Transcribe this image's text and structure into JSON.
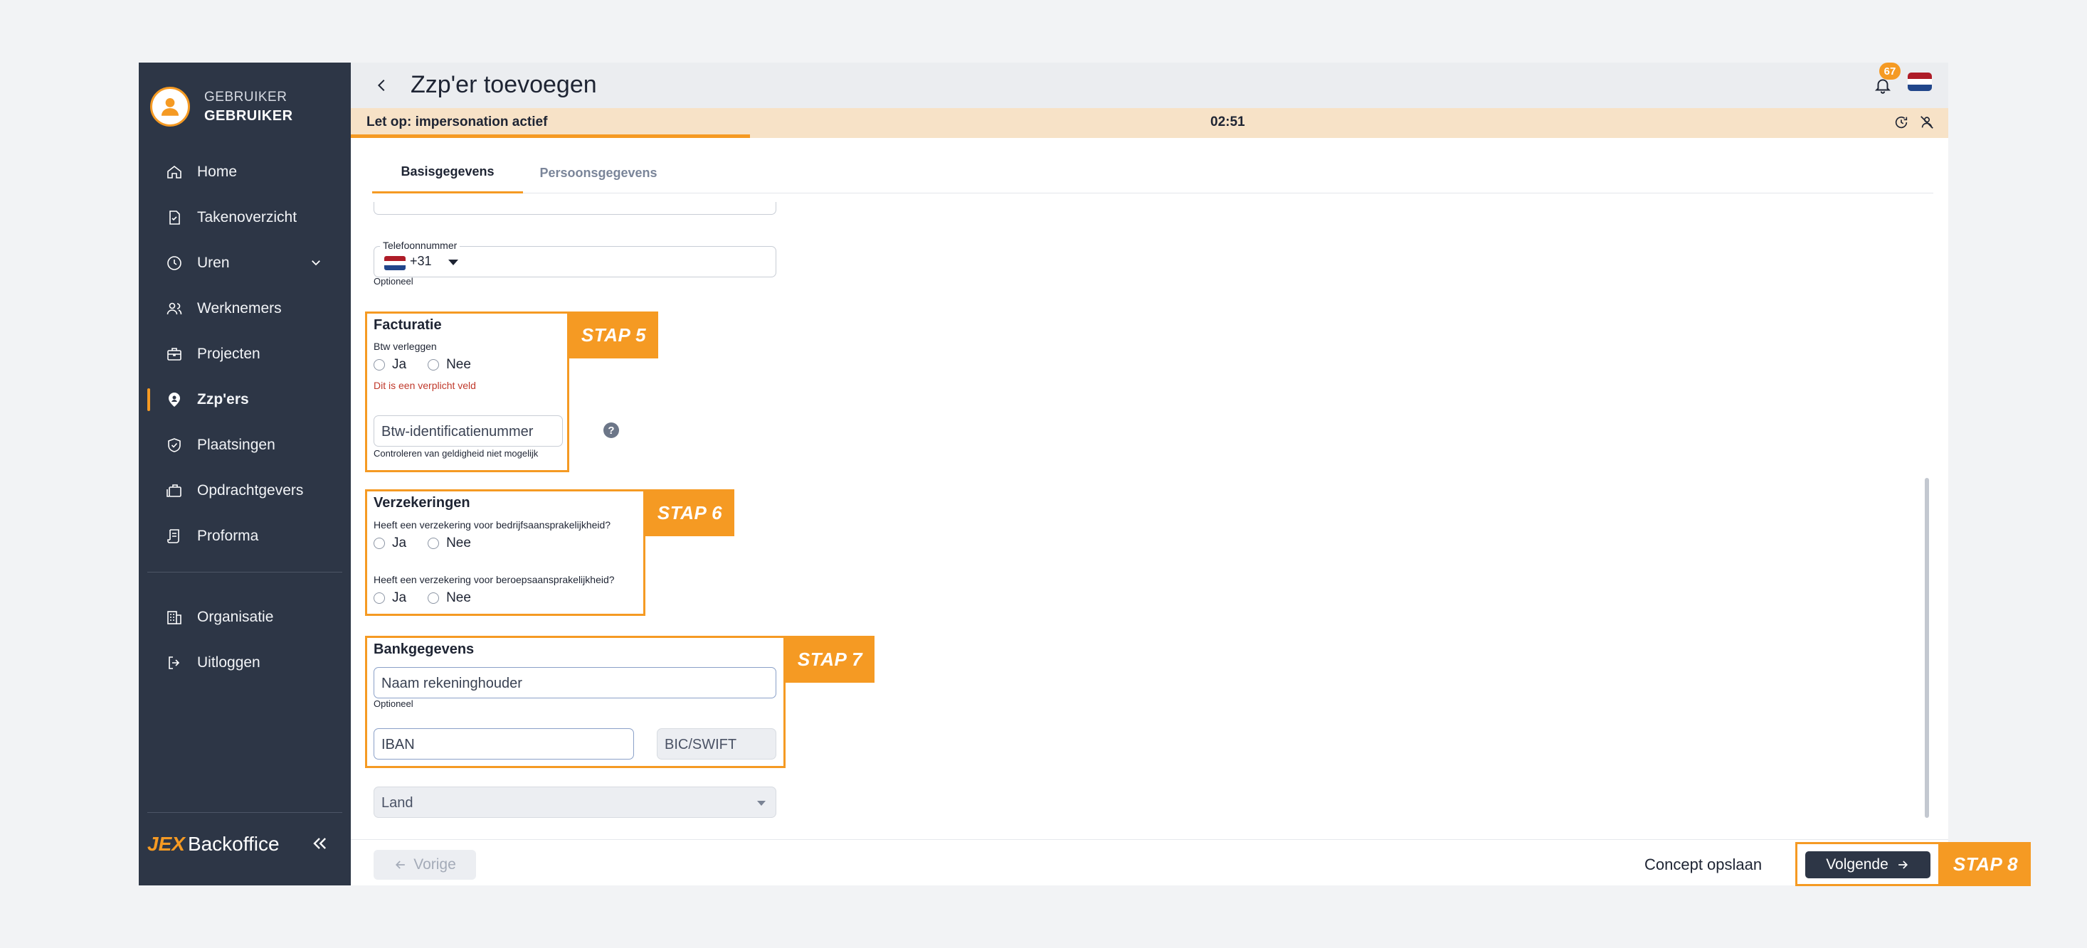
{
  "user": {
    "role": "GEBRUIKER",
    "name": "GEBRUIKER"
  },
  "nav": {
    "items": [
      {
        "label": "Home",
        "icon": "home-icon"
      },
      {
        "label": "Takenoverzicht",
        "icon": "task-icon"
      },
      {
        "label": "Uren",
        "icon": "clock-icon"
      },
      {
        "label": "Werknemers",
        "icon": "users-icon"
      },
      {
        "label": "Projecten",
        "icon": "briefcase-icon"
      },
      {
        "label": "Zzp'ers",
        "icon": "location-user-icon"
      },
      {
        "label": "Plaatsingen",
        "icon": "shield-check-icon"
      },
      {
        "label": "Opdrachtgevers",
        "icon": "suitcase-icon"
      },
      {
        "label": "Proforma",
        "icon": "receipt-icon"
      }
    ],
    "bottom_items": [
      {
        "label": "Organisatie",
        "icon": "building-icon"
      },
      {
        "label": "Uitloggen",
        "icon": "logout-icon"
      }
    ]
  },
  "brand": {
    "jex": "JEX",
    "name": "Backoffice"
  },
  "header": {
    "title": "Zzp'er toevoegen",
    "notification_count": "67"
  },
  "impersonation": {
    "text": "Let op: impersonation actief",
    "timer": "02:51",
    "progress": 0.25
  },
  "tabs": [
    {
      "label": "Basisgegevens"
    },
    {
      "label": "Persoonsgegevens"
    }
  ],
  "phone": {
    "label": "Telefoonnummer",
    "prefix": "+31",
    "hint": "Optioneel"
  },
  "facturatie": {
    "step": "STAP 5",
    "title": "Facturatie",
    "question": "Btw verleggen",
    "yes": "Ja",
    "no": "Nee",
    "error": "Dit is een verplicht veld",
    "btw_placeholder": "Btw-identificatienummer",
    "btw_hint": "Controleren van geldigheid niet mogelijk",
    "help": "?"
  },
  "verzekeringen": {
    "step": "STAP 6",
    "title": "Verzekeringen",
    "q1": "Heeft een verzekering voor bedrijfsaansprakelijkheid?",
    "q2": "Heeft een verzekering voor beroepsaansprakelijkheid?",
    "yes": "Ja",
    "no": "Nee"
  },
  "bank": {
    "step": "STAP 7",
    "title": "Bankgegevens",
    "holder_placeholder": "Naam rekeninghouder",
    "holder_hint": "Optioneel",
    "iban_placeholder": "IBAN",
    "bic_placeholder": "BIC/SWIFT"
  },
  "land": {
    "placeholder": "Land"
  },
  "footer": {
    "prev": "Vorige",
    "concept": "Concept opslaan",
    "next": "Volgende",
    "step": "STAP 8"
  },
  "colors": {
    "accent": "#f59a23",
    "sidebar": "#2d3646",
    "error": "#c0392b"
  }
}
